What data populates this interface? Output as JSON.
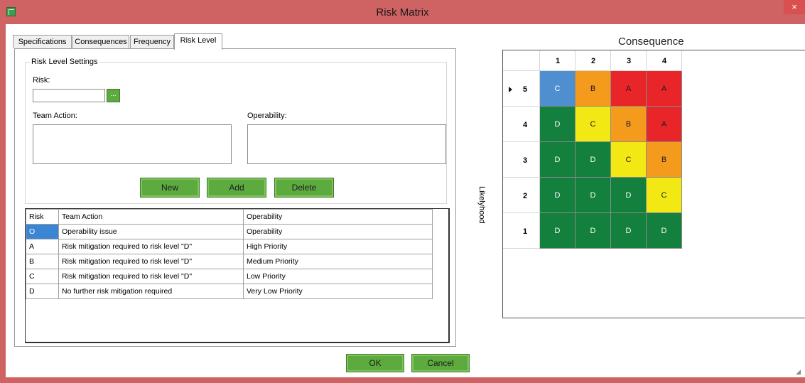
{
  "window": {
    "title": "Risk Matrix",
    "close_glyph": "×"
  },
  "tabs": [
    {
      "label": "Specifications",
      "active": false
    },
    {
      "label": "Consequences",
      "active": false
    },
    {
      "label": "Frequency",
      "active": false
    },
    {
      "label": "Risk Level",
      "active": true
    }
  ],
  "settings": {
    "legend": "Risk Level Settings",
    "risk_label": "Risk:",
    "risk_value": "",
    "browse_label": "...",
    "team_action_label": "Team Action:",
    "operability_label": "Operability:",
    "team_action_value": "",
    "operability_value": ""
  },
  "buttons": {
    "new": "New",
    "add": "Add",
    "delete": "Delete",
    "ok": "OK",
    "cancel": "Cancel"
  },
  "risk_table": {
    "columns": [
      "Risk",
      "Team Action",
      "Operability"
    ],
    "rows": [
      {
        "risk": "O",
        "team_action": "Operability issue",
        "operability": "Operability",
        "selected": true
      },
      {
        "risk": "A",
        "team_action": "Risk mitigation required to risk level \"D\"",
        "operability": "High Priority",
        "selected": false
      },
      {
        "risk": "B",
        "team_action": "Risk mitigation required to risk level \"D\"",
        "operability": "Medium Priority",
        "selected": false
      },
      {
        "risk": "C",
        "team_action": "Risk mitigation required to risk level \"D\"",
        "operability": "Low Priority",
        "selected": false
      },
      {
        "risk": "D",
        "team_action": "No further risk mitigation required",
        "operability": "Very Low Priority",
        "selected": false
      }
    ]
  },
  "matrix": {
    "title": "Consequence",
    "y_axis_label": "Likelyhood",
    "columns": [
      "1",
      "2",
      "3",
      "4"
    ],
    "rows": [
      {
        "label": "5",
        "current": true,
        "cells": [
          "C",
          "B",
          "A",
          "A"
        ]
      },
      {
        "label": "4",
        "current": false,
        "cells": [
          "D",
          "C",
          "B",
          "A"
        ]
      },
      {
        "label": "3",
        "current": false,
        "cells": [
          "D",
          "D",
          "C",
          "B"
        ]
      },
      {
        "label": "2",
        "current": false,
        "cells": [
          "D",
          "D",
          "D",
          "C"
        ]
      },
      {
        "label": "1",
        "current": false,
        "cells": [
          "D",
          "D",
          "D",
          "D"
        ]
      }
    ],
    "colors": {
      "blue": "#4f8fd0",
      "orange": "#f49b1e",
      "red": "#e8262a",
      "yellow": "#f2e914",
      "green": "#13803d"
    },
    "cell_colors": [
      [
        "blue",
        "orange",
        "red",
        "red"
      ],
      [
        "green",
        "yellow",
        "orange",
        "red"
      ],
      [
        "green",
        "green",
        "yellow",
        "orange"
      ],
      [
        "green",
        "green",
        "green",
        "yellow"
      ],
      [
        "green",
        "green",
        "green",
        "green"
      ]
    ]
  },
  "theme": {
    "titlebar": "#cf6262",
    "button_green": "#5daa3f",
    "selection": "#3b86d2"
  }
}
